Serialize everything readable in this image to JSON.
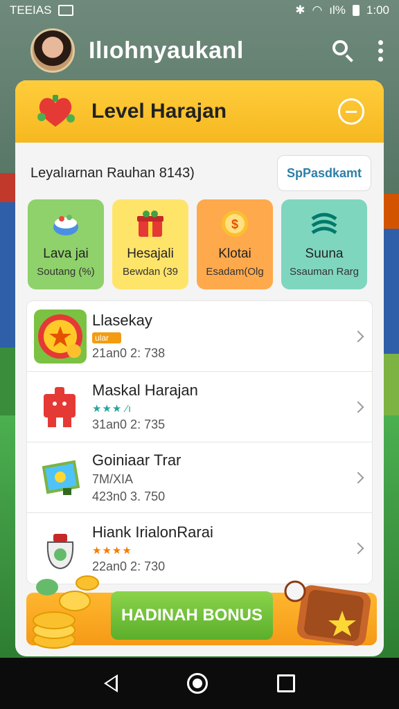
{
  "status_bar": {
    "left_text": "TEEIAS",
    "right_text": "ıl%",
    "time": "1:00"
  },
  "header": {
    "title": "Ilıohnyaukanl",
    "icons": [
      "avatar",
      "search-icon",
      "more-vert-icon"
    ]
  },
  "level_card": {
    "title": "Level Harajan",
    "subtitle": "Leyalıarnan Rauhan 8143)",
    "special_button_label": "SpPasdkamt",
    "colors": {
      "header": "#f8c22c",
      "accent": "#f39c12"
    }
  },
  "tiles": [
    {
      "label": "Lava jai",
      "sub": "Soutang (%)",
      "icon": "food-bowl-icon",
      "color": "#8fd16a"
    },
    {
      "label": "Hesajali",
      "sub": "Bewdan (39",
      "icon": "gift-icon",
      "color": "#ffe46a"
    },
    {
      "label": "Klotai",
      "sub": "Esadam(Olg",
      "icon": "coin-icon",
      "color": "#ffa94d"
    },
    {
      "label": "Suuna",
      "sub": "Ssauman Rarg",
      "icon": "wave-icon",
      "color": "#7fd6bf"
    }
  ],
  "list": [
    {
      "title": "Llasekay",
      "tag": "ular",
      "stars": "",
      "meta": "21an0 2: 738",
      "thumb": "star-coin-icon"
    },
    {
      "title": "Maskal Harajan",
      "tag": "",
      "stars": "★★★ ⁄ı",
      "meta": "31an0 2: 735",
      "thumb": "puzzle-icon"
    },
    {
      "title": "Goiniaar Trar",
      "tag": "",
      "stars": "7M/XIA",
      "meta": "423n0 3. 750",
      "thumb": "map-icon"
    },
    {
      "title": "Hiank IrialonRarai",
      "tag": "",
      "stars": "★★★★",
      "meta": "22an0 2: 730",
      "thumb": "money-bag-icon"
    }
  ],
  "bonus": {
    "label": "HADINAH BONUS"
  }
}
